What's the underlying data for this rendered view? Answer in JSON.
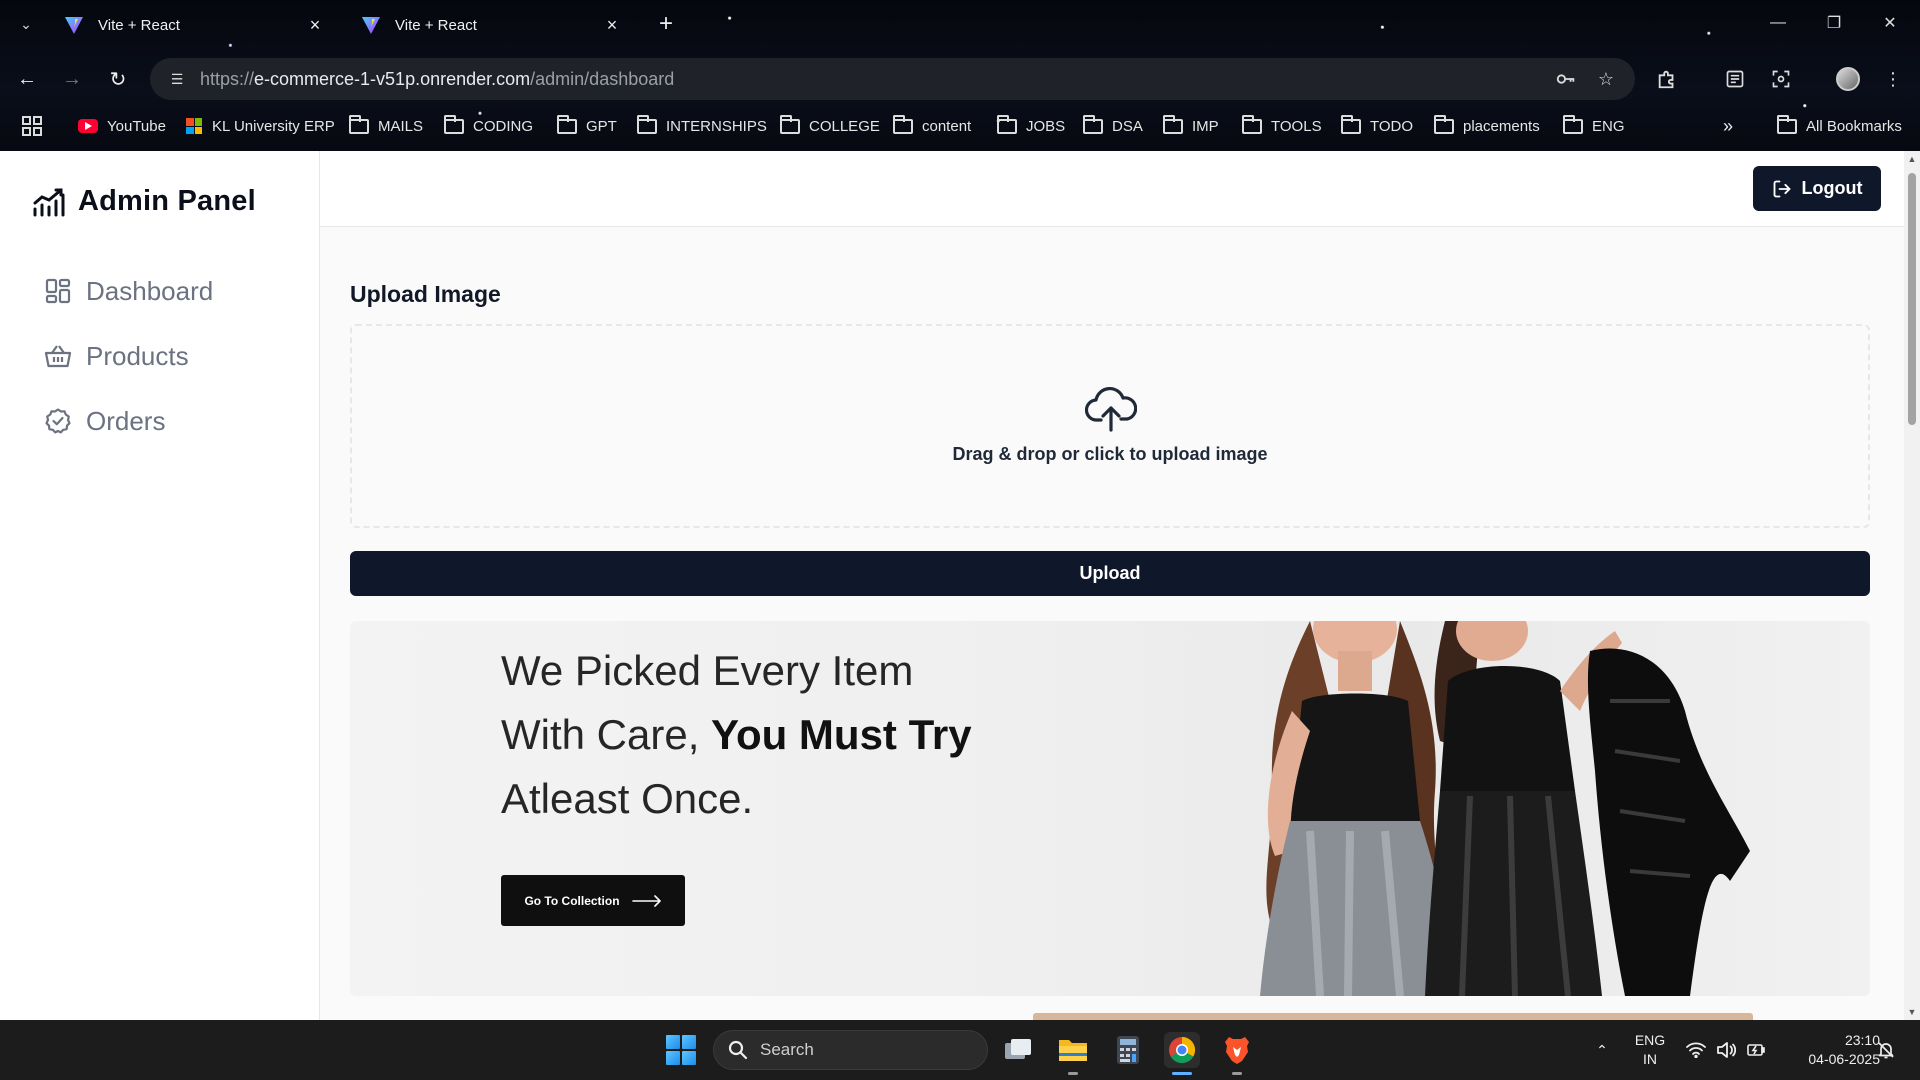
{
  "browser": {
    "tabs": [
      {
        "title": "Vite + React",
        "active": false
      },
      {
        "title": "Vite + React",
        "active": true
      }
    ],
    "url": {
      "scheme": "https://",
      "host": "e-commerce-1-v51p.onrender.com",
      "path": "/admin/dashboard"
    },
    "bookmarks": [
      {
        "label": "YouTube",
        "icon": "youtube-icon"
      },
      {
        "label": "KL University ERP",
        "icon": "microsoft-icon"
      },
      {
        "label": "MAILS",
        "icon": "folder-icon"
      },
      {
        "label": "CODING",
        "icon": "folder-icon"
      },
      {
        "label": "GPT",
        "icon": "folder-icon"
      },
      {
        "label": "INTERNSHIPS",
        "icon": "folder-icon"
      },
      {
        "label": "COLLEGE",
        "icon": "folder-icon"
      },
      {
        "label": "content",
        "icon": "folder-icon"
      },
      {
        "label": "JOBS",
        "icon": "folder-icon"
      },
      {
        "label": "DSA",
        "icon": "folder-icon"
      },
      {
        "label": "IMP",
        "icon": "folder-icon"
      },
      {
        "label": "TOOLS",
        "icon": "folder-icon"
      },
      {
        "label": "TODO",
        "icon": "folder-icon"
      },
      {
        "label": "placements",
        "icon": "folder-icon"
      },
      {
        "label": "ENG",
        "icon": "folder-icon"
      }
    ],
    "all_bookmarks_label": "All Bookmarks"
  },
  "sidebar": {
    "brand": "Admin Panel",
    "items": [
      {
        "label": "Dashboard",
        "icon": "dashboard-grid-icon"
      },
      {
        "label": "Products",
        "icon": "basket-icon"
      },
      {
        "label": "Orders",
        "icon": "check-circle-icon"
      }
    ]
  },
  "topbar": {
    "logout_label": "Logout"
  },
  "upload": {
    "title": "Upload Image",
    "drop_text": "Drag & drop or click to upload image",
    "button_label": "Upload"
  },
  "hero": {
    "line1": "We Picked Every Item",
    "line2_plain": "With Care, ",
    "line2_bold": "You Must Try",
    "line3": "Atleast Once.",
    "button_label": "Go To Collection"
  },
  "taskbar": {
    "search_placeholder": "Search",
    "lang_top": "ENG",
    "lang_bottom": "IN",
    "time": "23:10",
    "date": "04-06-2025"
  },
  "colors": {
    "primary": "#0f172a",
    "sidebar_text": "#6b7280"
  }
}
